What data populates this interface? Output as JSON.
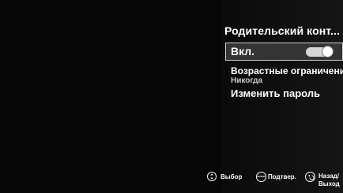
{
  "menu": {
    "title": "Родительский конт..."
  },
  "items": {
    "enabled": {
      "label": "Вкл.",
      "toggle_on": true
    },
    "age": {
      "label": "Возрастные ограничения",
      "value": "Никогда"
    },
    "password": {
      "label": "Изменить пароль"
    }
  },
  "hints": {
    "select": {
      "icon": "updown-arrows-icon",
      "label": "Выбор"
    },
    "confirm": {
      "icon": "enter-icon",
      "icon_text": "ENTER",
      "label": "Подтвер."
    },
    "back": {
      "icon": "back-arrow-icon",
      "label_line1": "Назад/",
      "label_line2": "Выход"
    }
  },
  "colors": {
    "background": "#050505",
    "selected_bg": "#343434",
    "selected_border": "#cfcfcf",
    "text": "#ffffff",
    "subtext": "#c8c8c8"
  }
}
